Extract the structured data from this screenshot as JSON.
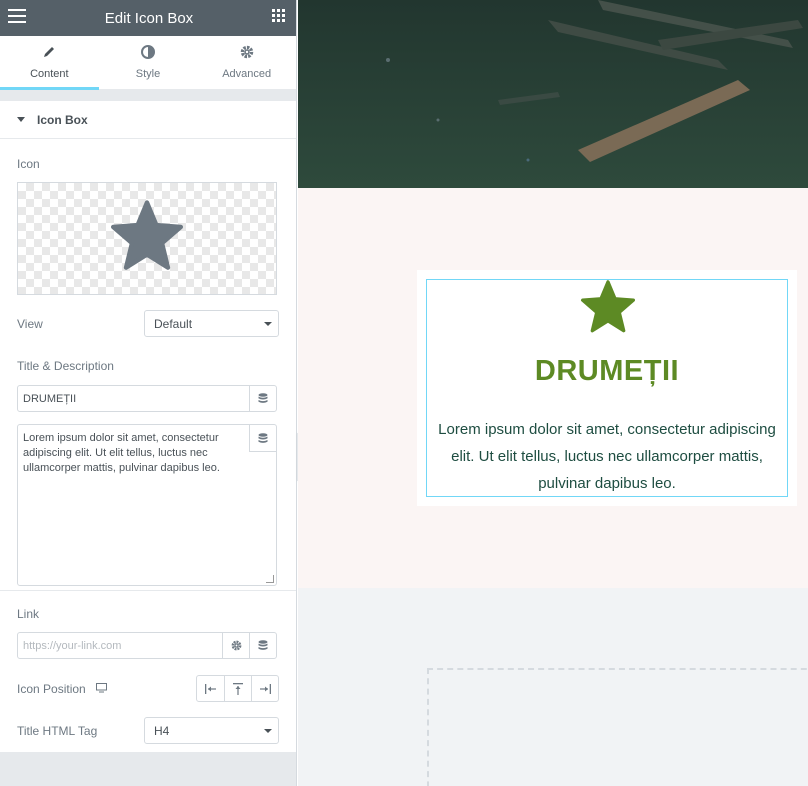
{
  "header": {
    "title": "Edit Icon Box"
  },
  "tabs": [
    {
      "label": "Content",
      "icon": "pencil-icon",
      "active": true
    },
    {
      "label": "Style",
      "icon": "half-circle-icon",
      "active": false
    },
    {
      "label": "Advanced",
      "icon": "gear-icon",
      "active": false
    }
  ],
  "section": {
    "title": "Icon Box"
  },
  "controls": {
    "icon_label": "Icon",
    "view_label": "View",
    "view_value": "Default",
    "title_desc_label": "Title & Description",
    "title_value": "DRUMEȚII",
    "description_value": "Lorem ipsum dolor sit amet, consectetur adipiscing elit. Ut elit tellus, luctus nec ullamcorper mattis, pulvinar dapibus leo.",
    "link_label": "Link",
    "link_placeholder": "https://your-link.com",
    "icon_position_label": "Icon Position",
    "title_tag_label": "Title HTML Tag",
    "title_tag_value": "H4"
  },
  "preview": {
    "title": "DRUMEȚII",
    "description": "Lorem ipsum dolor sit amet, consectetur adipiscing elit. Ut elit tellus, luctus nec ullamcorper mattis, pulvinar dapibus leo."
  },
  "colors": {
    "header_bg": "#556068",
    "accent": "#71d7f7",
    "icon_preview": "#6d7882",
    "title_green": "#5d8a24",
    "desc_green": "#1e4d41"
  }
}
